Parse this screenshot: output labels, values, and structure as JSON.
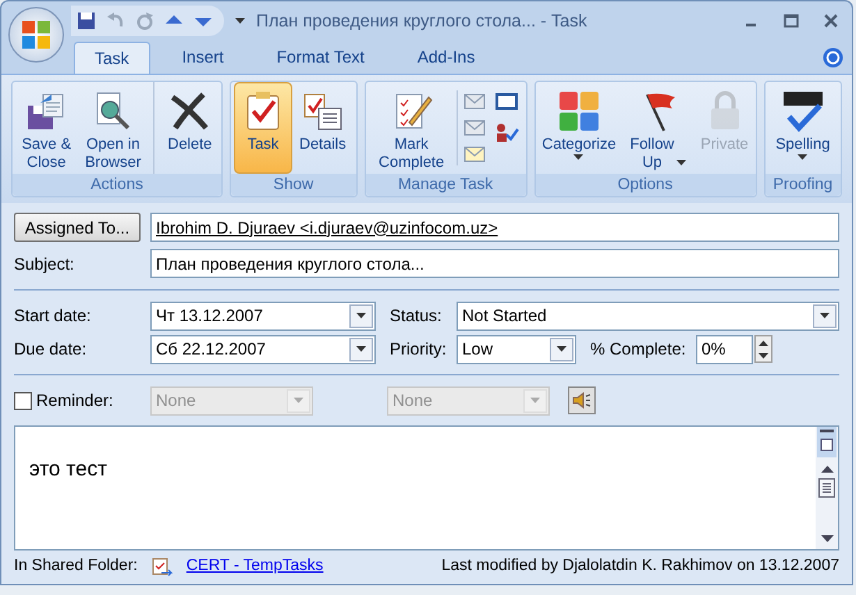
{
  "window": {
    "title": "План проведения круглого стола... - Task"
  },
  "tabs": [
    {
      "label": "Task",
      "selected": true
    },
    {
      "label": "Insert",
      "selected": false
    },
    {
      "label": "Format Text",
      "selected": false
    },
    {
      "label": "Add-Ins",
      "selected": false
    }
  ],
  "ribbon": {
    "groups": [
      {
        "label": "Actions",
        "buttons": [
          {
            "label": "Save &\nClose",
            "selected": false,
            "disabled": false,
            "dropdown": false
          },
          {
            "label": "Open in\nBrowser",
            "selected": false,
            "disabled": false,
            "dropdown": false
          },
          {
            "label": "Delete",
            "selected": false,
            "disabled": false,
            "dropdown": false
          }
        ]
      },
      {
        "label": "Show",
        "buttons": [
          {
            "label": "Task",
            "selected": true,
            "disabled": false,
            "dropdown": false
          },
          {
            "label": "Details",
            "selected": false,
            "disabled": false,
            "dropdown": false
          }
        ]
      },
      {
        "label": "Manage Task",
        "buttons": [
          {
            "label": "Mark\nComplete",
            "selected": false,
            "disabled": false,
            "dropdown": false
          }
        ]
      },
      {
        "label": "Options",
        "buttons": [
          {
            "label": "Categorize",
            "selected": false,
            "disabled": false,
            "dropdown": true
          },
          {
            "label": "Follow\nUp",
            "selected": false,
            "disabled": false,
            "dropdown": true
          },
          {
            "label": "Private",
            "selected": false,
            "disabled": true,
            "dropdown": false
          }
        ]
      },
      {
        "label": "Proofing",
        "buttons": [
          {
            "label": "Spelling",
            "selected": false,
            "disabled": false,
            "dropdown": true
          }
        ]
      }
    ]
  },
  "form": {
    "assigned_button": "Assigned To...",
    "assigned_value": "Ibrohim D. Djuraev <i.djuraev@uzinfocom.uz>",
    "subject_label": "Subject:",
    "subject_value": "План проведения круглого стола...",
    "start_label": "Start date:",
    "start_value": "Чт 13.12.2007",
    "status_label": "Status:",
    "status_value": "Not Started",
    "due_label": "Due date:",
    "due_value": "Сб 22.12.2007",
    "priority_label": "Priority:",
    "priority_value": "Low",
    "complete_label": "% Complete:",
    "complete_value": "0%",
    "reminder": {
      "label": "Reminder:",
      "checked": false,
      "date": "None",
      "time": "None"
    },
    "body": "это тест"
  },
  "footer": {
    "folder_label": "In Shared Folder:",
    "folder_link": "CERT - TempTasks",
    "last_modified": "Last modified by Djalolatdin K. Rakhimov on 13.12.2007"
  }
}
